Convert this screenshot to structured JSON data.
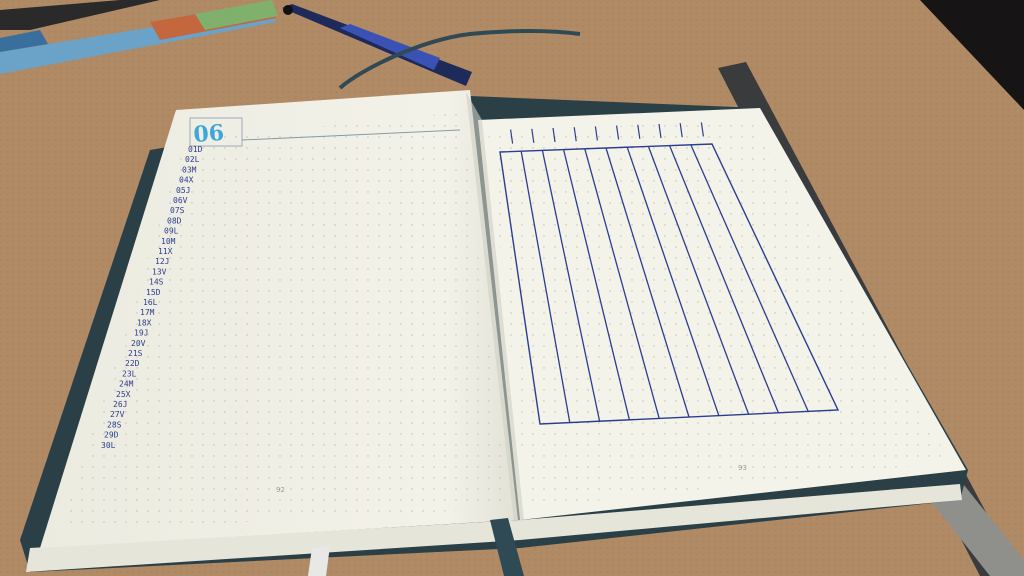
{
  "scene": {
    "description_items": [
      "cork-desk",
      "bullet-journal",
      "pens",
      "ruler",
      "ribbon-bookmark"
    ]
  },
  "journal": {
    "left_page": {
      "month_label": "06",
      "day_labels": [
        "01D",
        "02L",
        "03M",
        "04X",
        "05J",
        "06V",
        "07S",
        "08D",
        "09L",
        "10M",
        "11X",
        "12J",
        "13V",
        "14S",
        "15D",
        "16L",
        "17M",
        "18X",
        "19J",
        "20V",
        "21S",
        "22D",
        "23L",
        "24M",
        "25X",
        "26J",
        "27V",
        "28S",
        "29D",
        "30L"
      ],
      "page_number": "92"
    },
    "right_page": {
      "page_number": "93",
      "tracker_columns": 10
    }
  },
  "colors": {
    "desk": "#b08a64",
    "paper": "#f4f3ea",
    "ink_blue": "#2c3d8f",
    "accent_cyan": "#3fa6d8",
    "cover": "#2b3f46"
  }
}
